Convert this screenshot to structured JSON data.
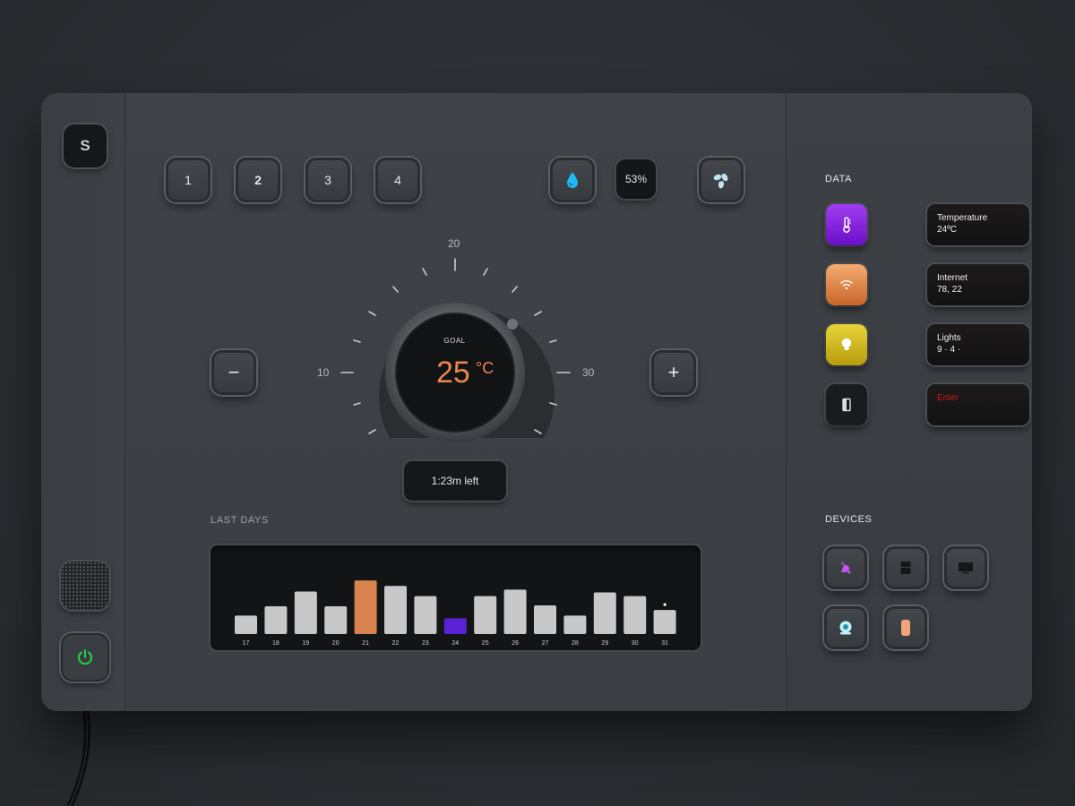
{
  "device": {
    "logo_letter": "S"
  },
  "presets": [
    "1",
    "2",
    "3",
    "4"
  ],
  "humidity": {
    "value": "53%"
  },
  "dial": {
    "goal_label": "GOAL",
    "temperature": "25",
    "unit": "°C",
    "scale": {
      "top": "20",
      "left": "10",
      "right": "30"
    },
    "time_left": "1:23m left"
  },
  "controls": {
    "minus": "−",
    "plus": "+"
  },
  "chart_section_title": "LAST DAYS",
  "chart_data": {
    "type": "bar",
    "categories": [
      "17",
      "18",
      "19",
      "20",
      "21",
      "22",
      "23",
      "24",
      "25",
      "26",
      "27",
      "28",
      "29",
      "30",
      "31"
    ],
    "values": [
      20,
      30,
      46,
      30,
      58,
      52,
      41,
      17,
      41,
      48,
      31,
      20,
      45,
      41,
      26
    ],
    "highlight": {
      "21": "#d8844e",
      "24": "#5b21d6"
    },
    "default_color": "#c8c8c8",
    "ylim": [
      0,
      60
    ],
    "title": "",
    "xlabel": "",
    "ylabel": ""
  },
  "data_panel": {
    "title": "DATA",
    "items": [
      {
        "icon": "thermometer-icon",
        "color": "#8a2be2",
        "label": "Temperature",
        "value": "24ºC"
      },
      {
        "icon": "wifi-icon",
        "color": "#e0884a",
        "label": "Internet",
        "value": "78, 22"
      },
      {
        "icon": "bulb-icon",
        "color": "#d8c020",
        "label": "Lights",
        "value": "9 ·   4 ·"
      },
      {
        "icon": "door-icon",
        "color": "#1a1b1d",
        "label": "Enter",
        "value": ""
      }
    ]
  },
  "devices_panel": {
    "title": "DEVICES",
    "items": [
      {
        "icon": "vacuum-icon"
      },
      {
        "icon": "fridge-icon"
      },
      {
        "icon": "tv-icon"
      },
      {
        "icon": "camera-icon"
      },
      {
        "icon": "speaker-icon"
      }
    ]
  }
}
